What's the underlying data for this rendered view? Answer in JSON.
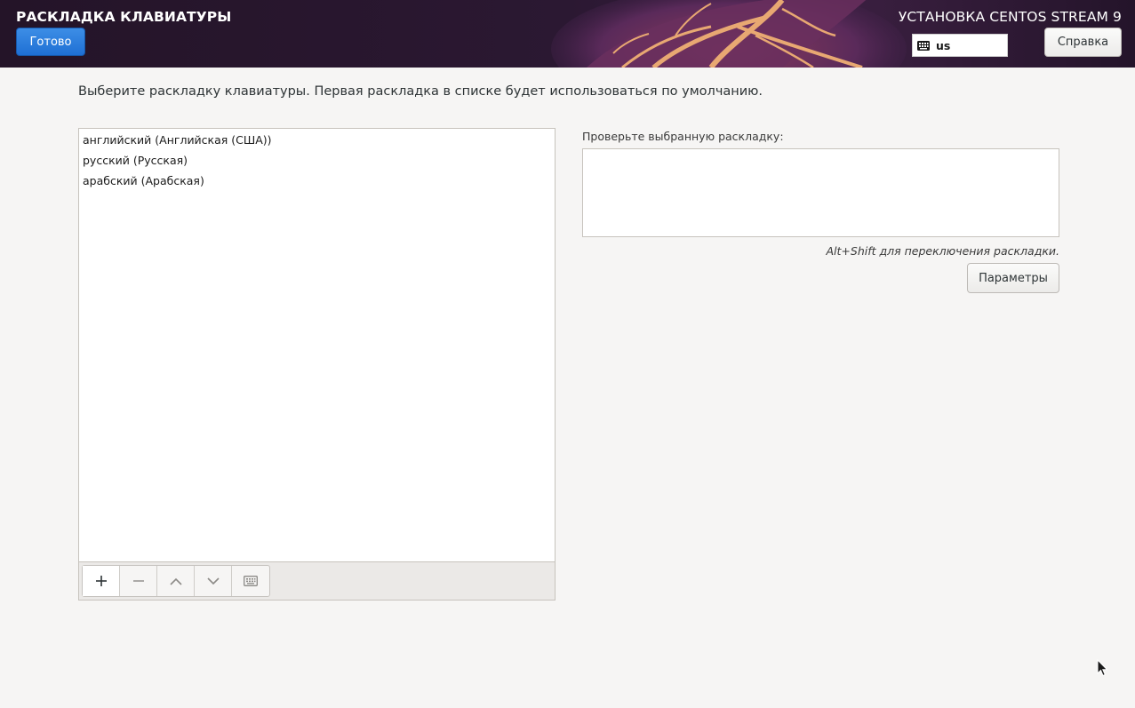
{
  "header": {
    "spoke_title": "РАСКЛАДКА КЛАВИАТУРЫ",
    "done_label": "Готово",
    "product_title": "УСТАНОВКА CENTOS STREAM 9",
    "layout_indicator": "us",
    "help_label": "Справка",
    "colors": {
      "done_button": "#1f6fd4",
      "banner_bg": "#2a1830",
      "vein": "#e8a872"
    }
  },
  "main": {
    "instructions": "Выберите раскладку клавиатуры. Первая раскладка в списке будет использоваться по умолчанию.",
    "layouts": [
      "английский (Английская (США))",
      "русский (Русская)",
      "арабский (Арабская)"
    ],
    "toolbar": {
      "buttons": [
        "add-icon",
        "remove-icon",
        "chevron-up-icon",
        "chevron-down-icon",
        "keyboard-icon"
      ]
    },
    "test_label": "Проверьте выбранную раскладку:",
    "switch_hint": "Alt+Shift для переключения раскладки.",
    "options_label": "Параметры"
  }
}
